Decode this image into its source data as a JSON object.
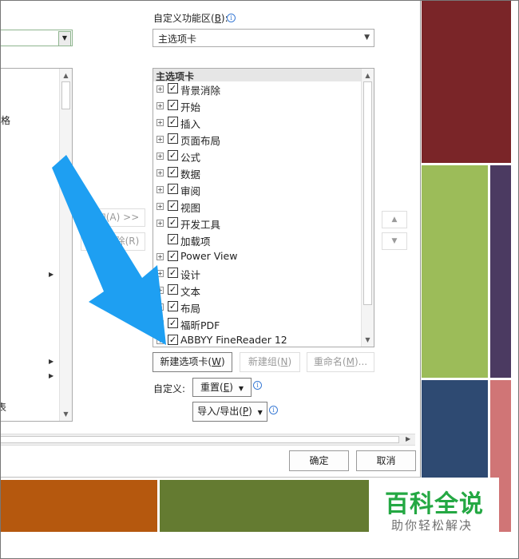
{
  "colors": {
    "tile_maroon": "#7a2528",
    "tile_green": "#9cbc59",
    "tile_purple": "#4b3a61",
    "tile_navy": "#2e4a72",
    "tile_pink": "#d07576",
    "tile_orange": "#b5580e",
    "tile_olive": "#647b31",
    "arrow_blue": "#1e9ff2",
    "watermark_green": "#24a843",
    "watermark_gray": "#6f6f6f"
  },
  "right_panel": {
    "customize_label": "自定义功能区(",
    "customize_key": "B",
    "customize_suffix": "):",
    "combo_value": "主选项卡",
    "tree_header": "主选项卡",
    "tree_items": [
      {
        "label": "背景消除",
        "expandable": true,
        "checked": true
      },
      {
        "label": "开始",
        "expandable": true,
        "checked": true
      },
      {
        "label": "插入",
        "expandable": true,
        "checked": true
      },
      {
        "label": "页面布局",
        "expandable": true,
        "checked": true
      },
      {
        "label": "公式",
        "expandable": true,
        "checked": true
      },
      {
        "label": "数据",
        "expandable": true,
        "checked": true
      },
      {
        "label": "审阅",
        "expandable": true,
        "checked": true
      },
      {
        "label": "视图",
        "expandable": true,
        "checked": true
      },
      {
        "label": "开发工具",
        "expandable": true,
        "checked": true
      },
      {
        "label": "加载项",
        "expandable": false,
        "checked": true
      },
      {
        "label": "Power View",
        "expandable": true,
        "checked": true
      },
      {
        "label": "设计",
        "expandable": true,
        "checked": true
      },
      {
        "label": "文本",
        "expandable": true,
        "checked": true
      },
      {
        "label": "布局",
        "expandable": true,
        "checked": true
      },
      {
        "label": "福昕PDF",
        "expandable": true,
        "checked": true
      },
      {
        "label": "ABBYY FineReader 12",
        "expandable": true,
        "checked": true
      }
    ],
    "new_tab_prefix": "新建选项卡(",
    "new_tab_key": "W",
    "new_tab_suffix": ")",
    "new_group_prefix": "新建组(",
    "new_group_key": "N",
    "new_group_suffix": ")",
    "rename_prefix": "重命名(",
    "rename_key": "M",
    "rename_suffix": ")...",
    "customize_row_label": "自定义:",
    "reset_prefix": "重置(",
    "reset_key": "E",
    "reset_suffix": ")",
    "import_prefix": "导入/导出(",
    "import_key": "P",
    "import_suffix": ")"
  },
  "middle": {
    "add_label": "添加(A) >>",
    "remove_label": "<< 删除(R)",
    "up_glyph": "▲",
    "down_glyph": "▼"
  },
  "left_panel": {
    "partial_item_1": "格",
    "partial_item_2": "表"
  },
  "footer": {
    "ok_label": "确定",
    "cancel_label": "取消"
  },
  "watermark": {
    "title": "百科全说",
    "subtitle": "助你轻松解决"
  },
  "icons": {
    "dropdown": "▼",
    "expander": "+",
    "check": "✓",
    "info": "i",
    "scroll_up": "▲",
    "scroll_down": "▼",
    "scroll_right": "▶",
    "submenu": "▶"
  }
}
